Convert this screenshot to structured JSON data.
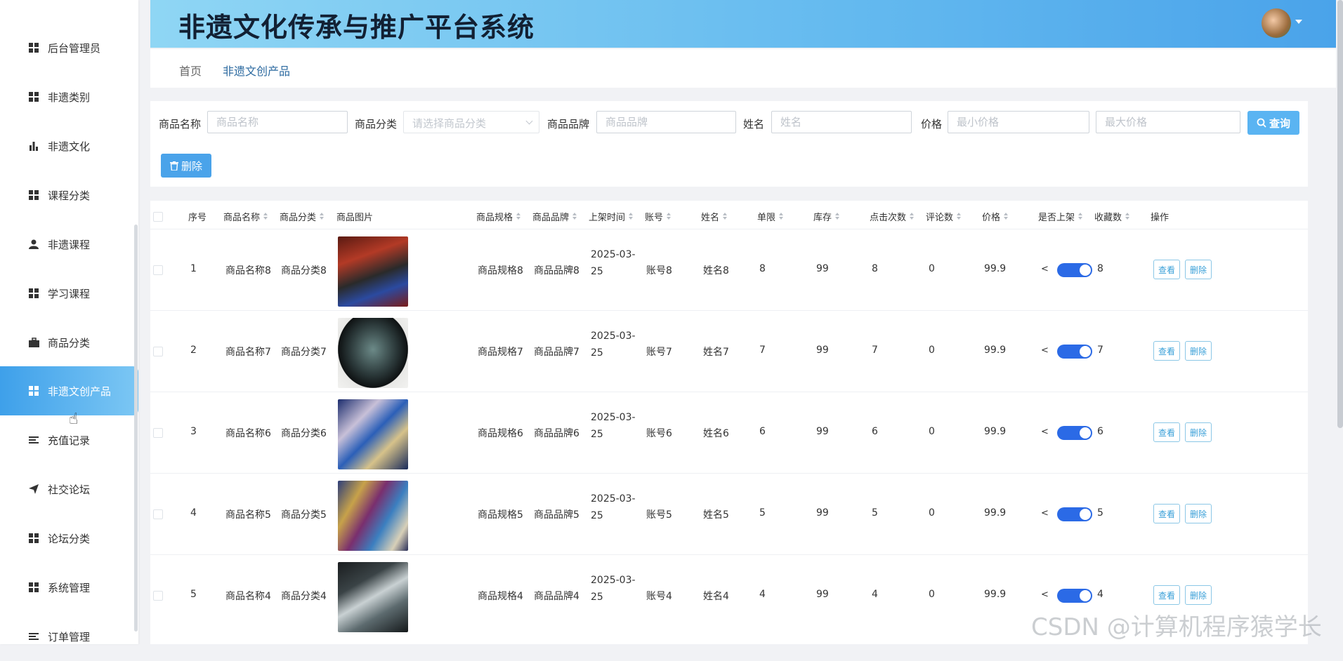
{
  "app": {
    "title": "非遗文化传承与推广平台系统"
  },
  "sidebar": {
    "items": [
      {
        "label": "后台管理员",
        "icon": "grid-icon"
      },
      {
        "label": "非遗类别",
        "icon": "grid-icon"
      },
      {
        "label": "非遗文化",
        "icon": "bar-chart-icon"
      },
      {
        "label": "课程分类",
        "icon": "grid-icon"
      },
      {
        "label": "非遗课程",
        "icon": "user-icon"
      },
      {
        "label": "学习课程",
        "icon": "grid-icon"
      },
      {
        "label": "商品分类",
        "icon": "briefcase-icon"
      },
      {
        "label": "非遗文创产品",
        "icon": "grid-icon",
        "active": true
      },
      {
        "label": "充值记录",
        "icon": "list-icon"
      },
      {
        "label": "社交论坛",
        "icon": "paper-plane-icon"
      },
      {
        "label": "论坛分类",
        "icon": "grid-icon"
      },
      {
        "label": "系统管理",
        "icon": "grid-icon"
      },
      {
        "label": "订单管理",
        "icon": "list-icon"
      }
    ]
  },
  "breadcrumb": {
    "home": "首页",
    "current": "非遗文创产品"
  },
  "filters": {
    "name_label": "商品名称",
    "name_placeholder": "商品名称",
    "category_label": "商品分类",
    "category_placeholder": "请选择商品分类",
    "brand_label": "商品品牌",
    "brand_placeholder": "商品品牌",
    "person_label": "姓名",
    "person_placeholder": "姓名",
    "price_label": "价格",
    "price_min_placeholder": "最小价格",
    "price_max_placeholder": "最大价格",
    "query_button": "查询",
    "delete_button": "删除"
  },
  "table": {
    "headers": {
      "index": "序号",
      "name": "商品名称",
      "category": "商品分类",
      "image": "商品图片",
      "spec": "商品规格",
      "brand": "商品品牌",
      "time": "上架时间",
      "account": "账号",
      "person": "姓名",
      "limit": "单限",
      "stock": "库存",
      "clicks": "点击次数",
      "comments": "评论数",
      "price": "价格",
      "listed": "是否上架",
      "favorites": "收藏数",
      "actions": "操作"
    },
    "rows": [
      {
        "index": "1",
        "name": "商品名称8",
        "category": "商品分类8",
        "spec": "商品规格8",
        "brand": "商品品牌8",
        "time": "2025-03-25",
        "account": "账号8",
        "person": "姓名8",
        "limit": "8",
        "stock": "99",
        "clicks": "8",
        "comments": "0",
        "price": "99.9",
        "favorites": "8",
        "view": "查看",
        "del": "删除"
      },
      {
        "index": "2",
        "name": "商品名称7",
        "category": "商品分类7",
        "spec": "商品规格7",
        "brand": "商品品牌7",
        "time": "2025-03-25",
        "account": "账号7",
        "person": "姓名7",
        "limit": "7",
        "stock": "99",
        "clicks": "7",
        "comments": "0",
        "price": "99.9",
        "favorites": "7",
        "view": "查看",
        "del": "删除"
      },
      {
        "index": "3",
        "name": "商品名称6",
        "category": "商品分类6",
        "spec": "商品规格6",
        "brand": "商品品牌6",
        "time": "2025-03-25",
        "account": "账号6",
        "person": "姓名6",
        "limit": "6",
        "stock": "99",
        "clicks": "6",
        "comments": "0",
        "price": "99.9",
        "favorites": "6",
        "view": "查看",
        "del": "删除"
      },
      {
        "index": "4",
        "name": "商品名称5",
        "category": "商品分类5",
        "spec": "商品规格5",
        "brand": "商品品牌5",
        "time": "2025-03-25",
        "account": "账号5",
        "person": "姓名5",
        "limit": "5",
        "stock": "99",
        "clicks": "5",
        "comments": "0",
        "price": "99.9",
        "favorites": "5",
        "view": "查看",
        "del": "删除"
      },
      {
        "index": "5",
        "name": "商品名称4",
        "category": "商品分类4",
        "spec": "商品规格4",
        "brand": "商品品牌4",
        "time": "2025-03-25",
        "account": "账号4",
        "person": "姓名4",
        "limit": "4",
        "stock": "99",
        "clicks": "4",
        "comments": "0",
        "price": "99.9",
        "favorites": "4",
        "view": "查看",
        "del": "删除"
      }
    ]
  },
  "watermark": "CSDN @计算机程序猿学长",
  "colors": {
    "accent": "#4aa3ea",
    "toggle_on": "#2b6ae6"
  }
}
